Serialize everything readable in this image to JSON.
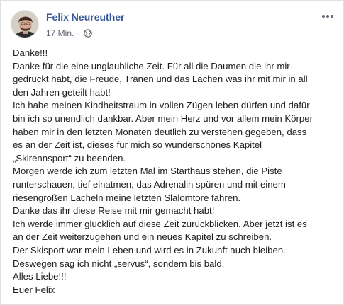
{
  "post": {
    "author_name": "Felix Neureuther",
    "timestamp": "17 Min.",
    "separator": "·",
    "privacy_icon": "globe-icon",
    "more_icon": "more-options-icon",
    "lines": [
      "Danke!!!",
      "Danke für die eine unglaubliche Zeit. Für all die Daumen die ihr mir",
      "gedrückt habt, die Freude, Tränen und das Lachen was ihr mit mir in all",
      "den Jahren geteilt habt!",
      "Ich habe meinen Kindheitstraum in vollen Zügen leben dürfen und dafür",
      "bin ich so unendlich dankbar. Aber mein Herz und vor allem mein Körper",
      "haben mir in den letzten Monaten deutlich zu verstehen gegeben, dass",
      "es an der Zeit ist, dieses für mich so wunderschönes Kapitel",
      "„Skirennsport“ zu beenden.",
      "Morgen werde ich zum letzten Mal im Starthaus stehen, die Piste",
      "runterschauen, tief einatmen, das Adrenalin spüren und mit einem",
      "riesengroßen Lächeln meine letzten Slalomtore fahren.",
      "Danke das ihr diese Reise mit mir gemacht habt!",
      "Ich werde immer glücklich auf diese Zeit zurückblicken. Aber jetzt ist es",
      "an der Zeit weiterzugehen und ein neues Kapitel zu schreiben.",
      "Der Skisport war mein Leben und wird es in Zukunft auch bleiben.",
      "Deswegen sag ich nicht „servus“, sondern bis bald.",
      "Alles Liebe!!!",
      "Euer Felix"
    ]
  },
  "colors": {
    "author": "#385898",
    "meta": "#616770",
    "text": "#1c1e21",
    "border": "#dddfe2"
  }
}
